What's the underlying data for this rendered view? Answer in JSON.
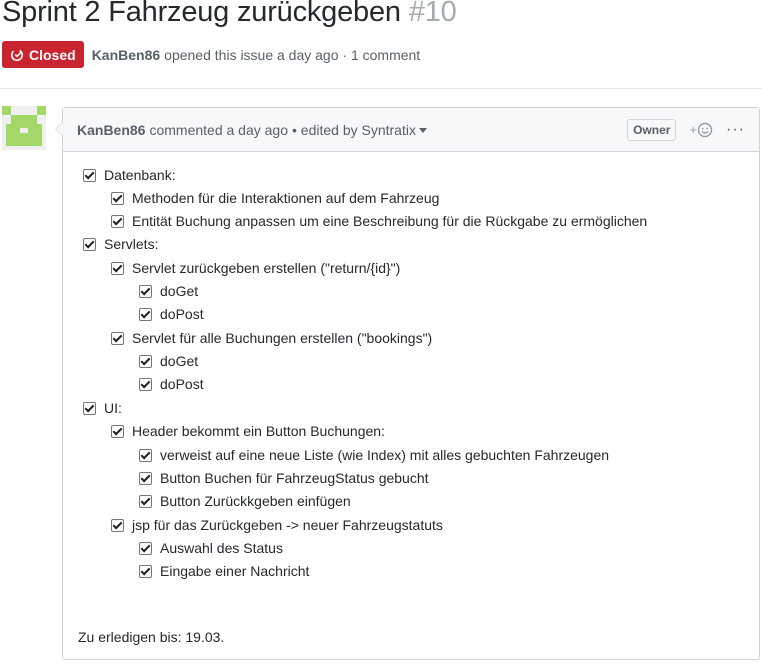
{
  "issue": {
    "title": "Sprint 2 Fahrzeug zurückgeben",
    "number": "#10",
    "status": "Closed",
    "author": "KanBen86",
    "opened_text": "opened this issue a day ago · 1 comment"
  },
  "colors": {
    "closed": "#cb2431",
    "avatar_green": "#a2d868"
  },
  "comment": {
    "author": "KanBen86",
    "meta": "commented a day ago",
    "edited": "• edited by Syntratix",
    "owner_badge": "Owner",
    "react_icon": "smiley-icon",
    "more_icon": "kebab-horizontal-icon",
    "tasks": [
      {
        "label": "Datenbank:",
        "level": 0,
        "checked": true
      },
      {
        "label": "Methoden für die Interaktionen auf dem Fahrzeug",
        "level": 1,
        "checked": true
      },
      {
        "label": "Entität Buchung anpassen um eine Beschreibung für die Rückgabe zu ermöglichen",
        "level": 1,
        "checked": true
      },
      {
        "label": "Servlets:",
        "level": 0,
        "checked": true
      },
      {
        "label": "Servlet zurückgeben erstellen (\"return/{id}\")",
        "level": 1,
        "checked": true
      },
      {
        "label": "doGet",
        "level": 2,
        "checked": true
      },
      {
        "label": "doPost",
        "level": 2,
        "checked": true
      },
      {
        "label": "Servlet für alle Buchungen erstellen (\"bookings\")",
        "level": 1,
        "checked": true
      },
      {
        "label": "doGet",
        "level": 2,
        "checked": true
      },
      {
        "label": "doPost",
        "level": 2,
        "checked": true
      },
      {
        "label": "UI:",
        "level": 0,
        "checked": true
      },
      {
        "label": "Header bekommt ein Button Buchungen:",
        "level": 1,
        "checked": true
      },
      {
        "label": "verweist auf eine neue Liste (wie Index) mit alles gebuchten Fahrzeugen",
        "level": 2,
        "checked": true
      },
      {
        "label": "Button Buchen für FahrzeugStatus gebucht",
        "level": 2,
        "checked": true
      },
      {
        "label": "Button Zurückkgeben einfügen",
        "level": 2,
        "checked": true
      },
      {
        "label": "jsp für das Zurückgeben -> neuer Fahrzeugstatuts",
        "level": 1,
        "checked": true
      },
      {
        "label": "Auswahl des Status",
        "level": 2,
        "checked": true
      },
      {
        "label": "Eingabe einer Nachricht",
        "level": 2,
        "checked": true
      }
    ],
    "footer": "Zu erledigen bis: 19.03."
  }
}
